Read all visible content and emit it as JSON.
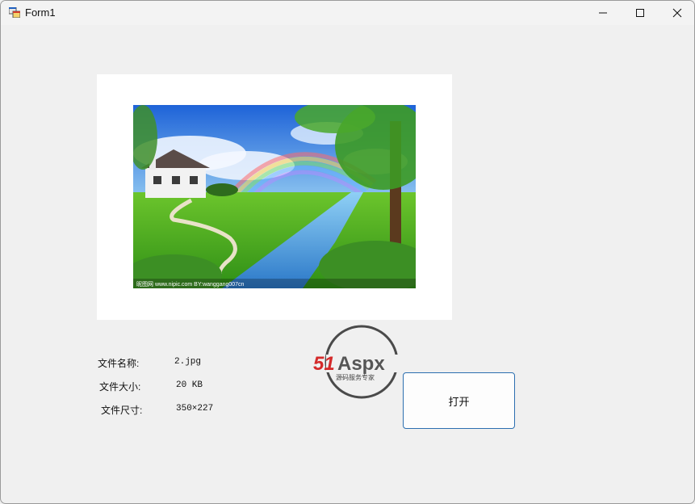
{
  "window": {
    "title": "Form1"
  },
  "image": {
    "watermark": "昵图网 www.nipic.com  BY:wanggang007cn"
  },
  "file_info": {
    "name_label": "文件名称:",
    "name_value": "2.jpg",
    "size_label": "文件大小:",
    "size_value": "20 KB",
    "dims_label": "文件尺寸:",
    "dims_value": "350×227"
  },
  "buttons": {
    "open_label": "打开"
  },
  "logo": {
    "brand_51": "51",
    "brand_aspx": "Aspx",
    "tagline": "源码服务专家"
  },
  "colors": {
    "accent": "#2c6fb0",
    "logo_red": "#d42a2a",
    "logo_green": "#3aa53a"
  }
}
